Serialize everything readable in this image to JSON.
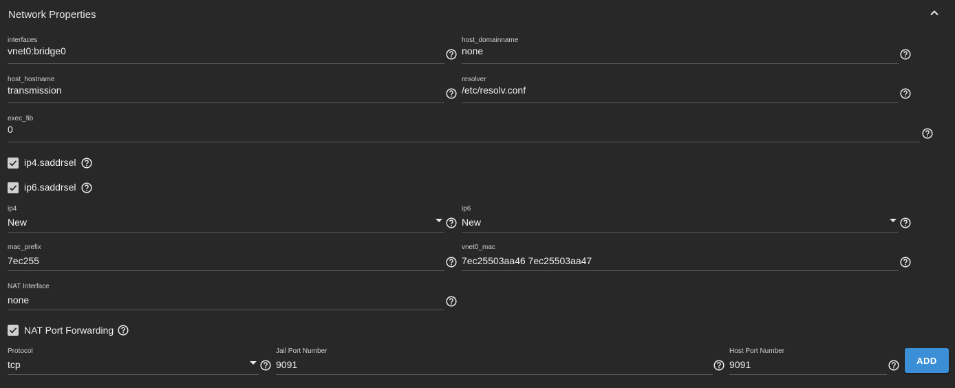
{
  "section": {
    "title": "Network Properties",
    "collapse_icon": "chevron-up-icon"
  },
  "fields": {
    "interfaces": {
      "label": "interfaces",
      "value": "vnet0:bridge0"
    },
    "host_domainname": {
      "label": "host_domainname",
      "value": "none"
    },
    "host_hostname": {
      "label": "host_hostname",
      "value": "transmission"
    },
    "resolver": {
      "label": "resolver",
      "value": "/etc/resolv.conf"
    },
    "exec_fib": {
      "label": "exec_fib",
      "value": "0"
    },
    "ip4": {
      "label": "ip4",
      "value": "New"
    },
    "ip6": {
      "label": "ip6",
      "value": "New"
    },
    "mac_prefix": {
      "label": "mac_prefix",
      "value": "7ec255"
    },
    "vnet0_mac": {
      "label": "vnet0_mac",
      "value": "7ec25503aa46 7ec25503aa47"
    },
    "nat_interface": {
      "label": "NAT Interface",
      "value": "none"
    }
  },
  "checkboxes": {
    "ip4_saddrsel": {
      "label": "ip4.saddrsel",
      "checked": true
    },
    "ip6_saddrsel": {
      "label": "ip6.saddrsel",
      "checked": true
    },
    "nat_port_forwarding": {
      "label": "NAT Port Forwarding",
      "checked": true
    }
  },
  "port_forwarding": {
    "protocol": {
      "label": "Protocol",
      "value": "tcp"
    },
    "jail_port": {
      "label": "Jail Port Number",
      "value": "9091"
    },
    "host_port": {
      "label": "Host Port Number",
      "value": "9091"
    },
    "add_label": "ADD"
  },
  "colors": {
    "background": "#282828",
    "accent": "#3a8fd6",
    "underline": "#5a5a5a"
  }
}
